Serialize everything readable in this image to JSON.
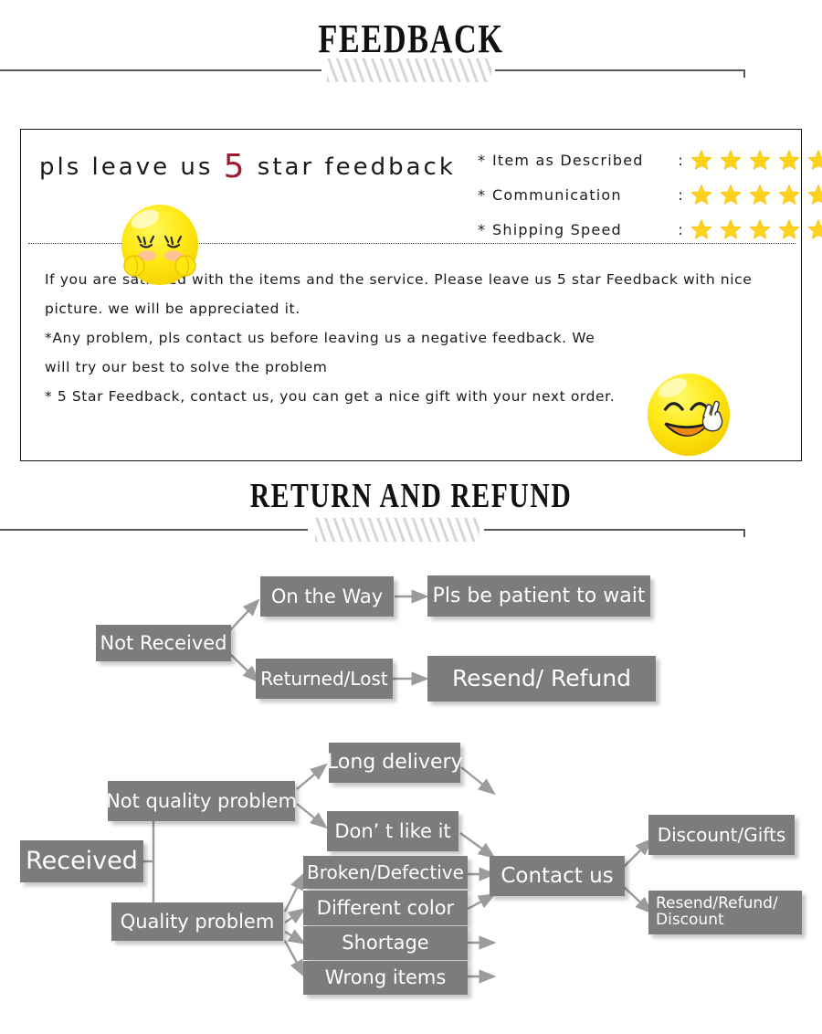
{
  "sections": {
    "feedback_title": "FEEDBACK",
    "return_title": "RETURN  AND  REFUND"
  },
  "feedback": {
    "headline_before": "pls  leave  us  ",
    "headline_number": "5",
    "headline_after": "  star  feedback",
    "ratings": [
      {
        "bullet": "*",
        "label": "Item as Described",
        "colon": ":",
        "stars": 5
      },
      {
        "bullet": "*",
        "label": "Communication",
        "colon": ":",
        "stars": 5
      },
      {
        "bullet": "*",
        "label": "Shipping Speed",
        "colon": ":",
        "stars": 5
      }
    ],
    "body_lines": [
      "If you are satisfied with the items and the service. Please leave us 5 star Feedback with nice",
      "picture. we will be appreciated it.",
      "*Any problem, pls contact us before leaving us a negative feedback. We",
      "will try our best to solve  the problem",
      "* 5 Star Feedback, contact us, you can get a nice gift with your next order."
    ],
    "emoji_shy_name": "shy-blushing-emoji",
    "emoji_peace_name": "smiling-peace-sign-emoji"
  },
  "flowchart": {
    "nodes": {
      "not_received": "Not Received",
      "on_the_way": "On the Way",
      "pls_be_patient": "Pls be patient to wait",
      "returned_lost": "Returned/Lost",
      "resend_refund": "Resend/ Refund",
      "received": "Received",
      "not_quality_problem": "Not quality problem",
      "long_delivery": "Long delivery",
      "dont_like_it": "Don’  t like it",
      "quality_problem": "Quality problem",
      "broken_defective": "Broken/Defective",
      "different_color": "Different color",
      "shortage": "Shortage",
      "wrong_items": "Wrong items",
      "contact_us": "Contact us",
      "discount_gifts": "Discount/Gifts",
      "resend_refund_discount_l1": "Resend/Refund/",
      "resend_refund_discount_l2": "Discount"
    }
  },
  "colors": {
    "node_fill": "#7c7c7c",
    "node_text": "#ffffff",
    "arrow": "#9b9b9b",
    "star": "#ffd21e",
    "accent_number": "#9e1b2f",
    "rule": "#555a5c"
  }
}
